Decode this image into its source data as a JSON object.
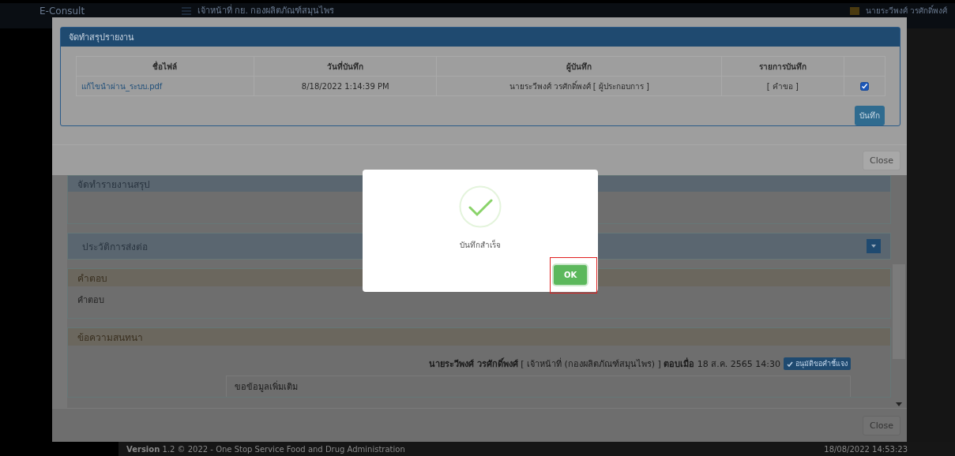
{
  "header": {
    "brand": "E-Consult",
    "title": "เจ้าหน้าที่ กย. กองผลิตภัณฑ์สมุนไพร",
    "user": "นายระวีพงศ์ วรศักดิ์พงศ์"
  },
  "footer": {
    "version": "**Version** 1.2 © 2022 - One Stop Service Food and Drug Administration",
    "datetime": "18/08/2022 14:53:23"
  },
  "detail_modal": {
    "panels": [
      {
        "kind": "empty",
        "title": "จัดทำรายงานสรุป"
      },
      {
        "kind": "collapsible",
        "title": "ประวัติการส่งต่อ",
        "expanded": false
      },
      {
        "kind": "text",
        "title": "คำตอบ",
        "body": "คำตอบ"
      },
      {
        "kind": "chat",
        "title": "ข้อความสนทนา",
        "author_line": "**นายระวีพงศ์ วรศักดิ์พงศ์** [ เจ้าหน้าที่ (กองผลิตภัณฑ์สมุนไพร) ] **ตอบเมื่อ** 18 ส.ค. 2565 14:30",
        "badge": "อนุมัติขอคำชี้แจง",
        "message": "ขอข้อมูลเพิ่มเติม"
      }
    ],
    "close_button": "Close"
  },
  "report_modal": {
    "title": "จัดทำสรุปรายงาน",
    "columns": [
      "ชื่อไฟล์",
      "วันที่บันทึก",
      "ผู้บันทึก",
      "รายการบันทึก"
    ],
    "rows": [
      {
        "file_name": "แก้ไขนำผ่าน_ระบบ.pdf",
        "saved_at": "8/18/2022 1:14:39 PM",
        "saved_by": "นายระวีพงศ์ วรศักดิ์พงศ์ [ ผู้ประกอบการ ]",
        "record": "[ คำขอ ]",
        "checked": true
      }
    ],
    "save_button": "บันทึก",
    "close_button": "Close"
  },
  "success_dialog": {
    "message": "บันทึกสำเร็จ",
    "ok_button": "OK",
    "highlighted": true
  }
}
